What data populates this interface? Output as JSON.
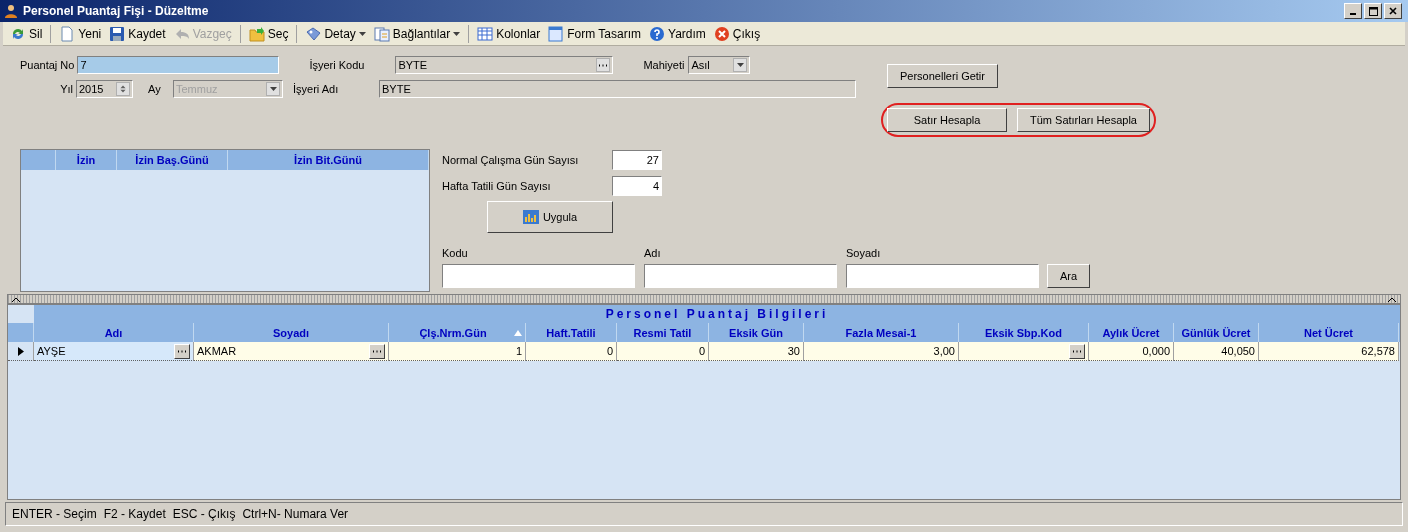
{
  "window": {
    "title": "Personel Puantaj Fişi - Düzeltme"
  },
  "toolbar": [
    {
      "kind": "button",
      "label": "Sil",
      "disabled": false
    },
    {
      "kind": "separator"
    },
    {
      "kind": "button",
      "label": "Yeni",
      "disabled": false
    },
    {
      "kind": "button",
      "label": "Kaydet",
      "disabled": false
    },
    {
      "kind": "button",
      "label": "Vazgeç",
      "disabled": true
    },
    {
      "kind": "separator"
    },
    {
      "kind": "button",
      "label": "Seç",
      "disabled": false
    },
    {
      "kind": "separator"
    },
    {
      "kind": "dropdown",
      "label": "Detay",
      "disabled": false
    },
    {
      "kind": "dropdown",
      "label": "Bağlantılar",
      "disabled": false
    },
    {
      "kind": "separator"
    },
    {
      "kind": "button",
      "label": "Kolonlar",
      "disabled": false
    },
    {
      "kind": "button",
      "label": "Form Tasarım",
      "disabled": false
    },
    {
      "kind": "button",
      "label": "Yardım",
      "disabled": false
    },
    {
      "kind": "button",
      "label": "Çıkış",
      "disabled": false
    }
  ],
  "form": {
    "puantaj_no": {
      "label": "Puantaj No",
      "value": "7"
    },
    "yil": {
      "label": "Yıl",
      "value": "2015"
    },
    "ay": {
      "label": "Ay",
      "value": "Temmuz",
      "disabled": true
    },
    "isyeri_kodu": {
      "label": "İşyeri Kodu",
      "value": "BYTE"
    },
    "mahiyeti": {
      "label": "Mahiyeti",
      "value": "Asıl"
    },
    "isyeri_adi": {
      "label": "İşyeri Adı",
      "value": "BYTE"
    },
    "buttons": [
      {
        "label": "Personelleri Getir",
        "highlighted": false
      },
      {
        "label": "Satır Hesapla",
        "highlighted": true
      },
      {
        "label": "Tüm Satırları Hesapla",
        "highlighted": true
      }
    ]
  },
  "izin_grid": {
    "columns": [
      "İzin",
      "İzin Baş.Günü",
      "İzin Bit.Günü"
    ]
  },
  "calisma": {
    "fields": [
      {
        "label": "Normal Çalışma Gün Sayısı",
        "value": "27"
      },
      {
        "label": "Hafta Tatili Gün Sayısı",
        "value": "4"
      }
    ],
    "apply_button": "Uygula"
  },
  "search": {
    "fields": [
      {
        "label": "Kodu"
      },
      {
        "label": "Adı"
      },
      {
        "label": "Soyadı"
      }
    ],
    "button": "Ara"
  },
  "table": {
    "title": "Personel Puantaj Bilgileri",
    "columns": [
      {
        "label": "Adı",
        "kind": "lookup",
        "sorted": false
      },
      {
        "label": "Soyadı",
        "kind": "lookup",
        "sorted": false
      },
      {
        "label": "Çlş.Nrm.Gün",
        "kind": "number",
        "sorted": true
      },
      {
        "label": "Haft.Tatili",
        "kind": "number",
        "sorted": false
      },
      {
        "label": "Resmi Tatil",
        "kind": "number",
        "sorted": false
      },
      {
        "label": "Eksik Gün",
        "kind": "number",
        "sorted": false
      },
      {
        "label": "Fazla Mesai-1",
        "kind": "number",
        "sorted": false
      },
      {
        "label": "Eksik Sbp.Kod",
        "kind": "lookup",
        "sorted": false
      },
      {
        "label": "Aylık Ücret",
        "kind": "number",
        "sorted": false
      },
      {
        "label": "Günlük Ücret",
        "kind": "number",
        "sorted": false
      },
      {
        "label": "Net Ücret",
        "kind": "number",
        "sorted": false
      }
    ],
    "rows": [
      {
        "selected": true,
        "cells": [
          {
            "value": "AYŞE",
            "focused": true
          },
          {
            "value": "AKMAR",
            "focused": false
          },
          {
            "value": "1",
            "focused": false
          },
          {
            "value": "0",
            "focused": false
          },
          {
            "value": "0",
            "focused": false
          },
          {
            "value": "30",
            "focused": false
          },
          {
            "value": "3,00",
            "focused": false
          },
          {
            "focused": false
          },
          {
            "value": "0,000",
            "focused": false
          },
          {
            "value": "40,050",
            "focused": false
          },
          {
            "value": "62,578",
            "focused": false
          }
        ]
      }
    ]
  },
  "status_bar": [
    "ENTER - Seçim",
    "F2 - Kaydet",
    "ESC - Çıkış",
    "Ctrl+N- Numara Ver"
  ]
}
